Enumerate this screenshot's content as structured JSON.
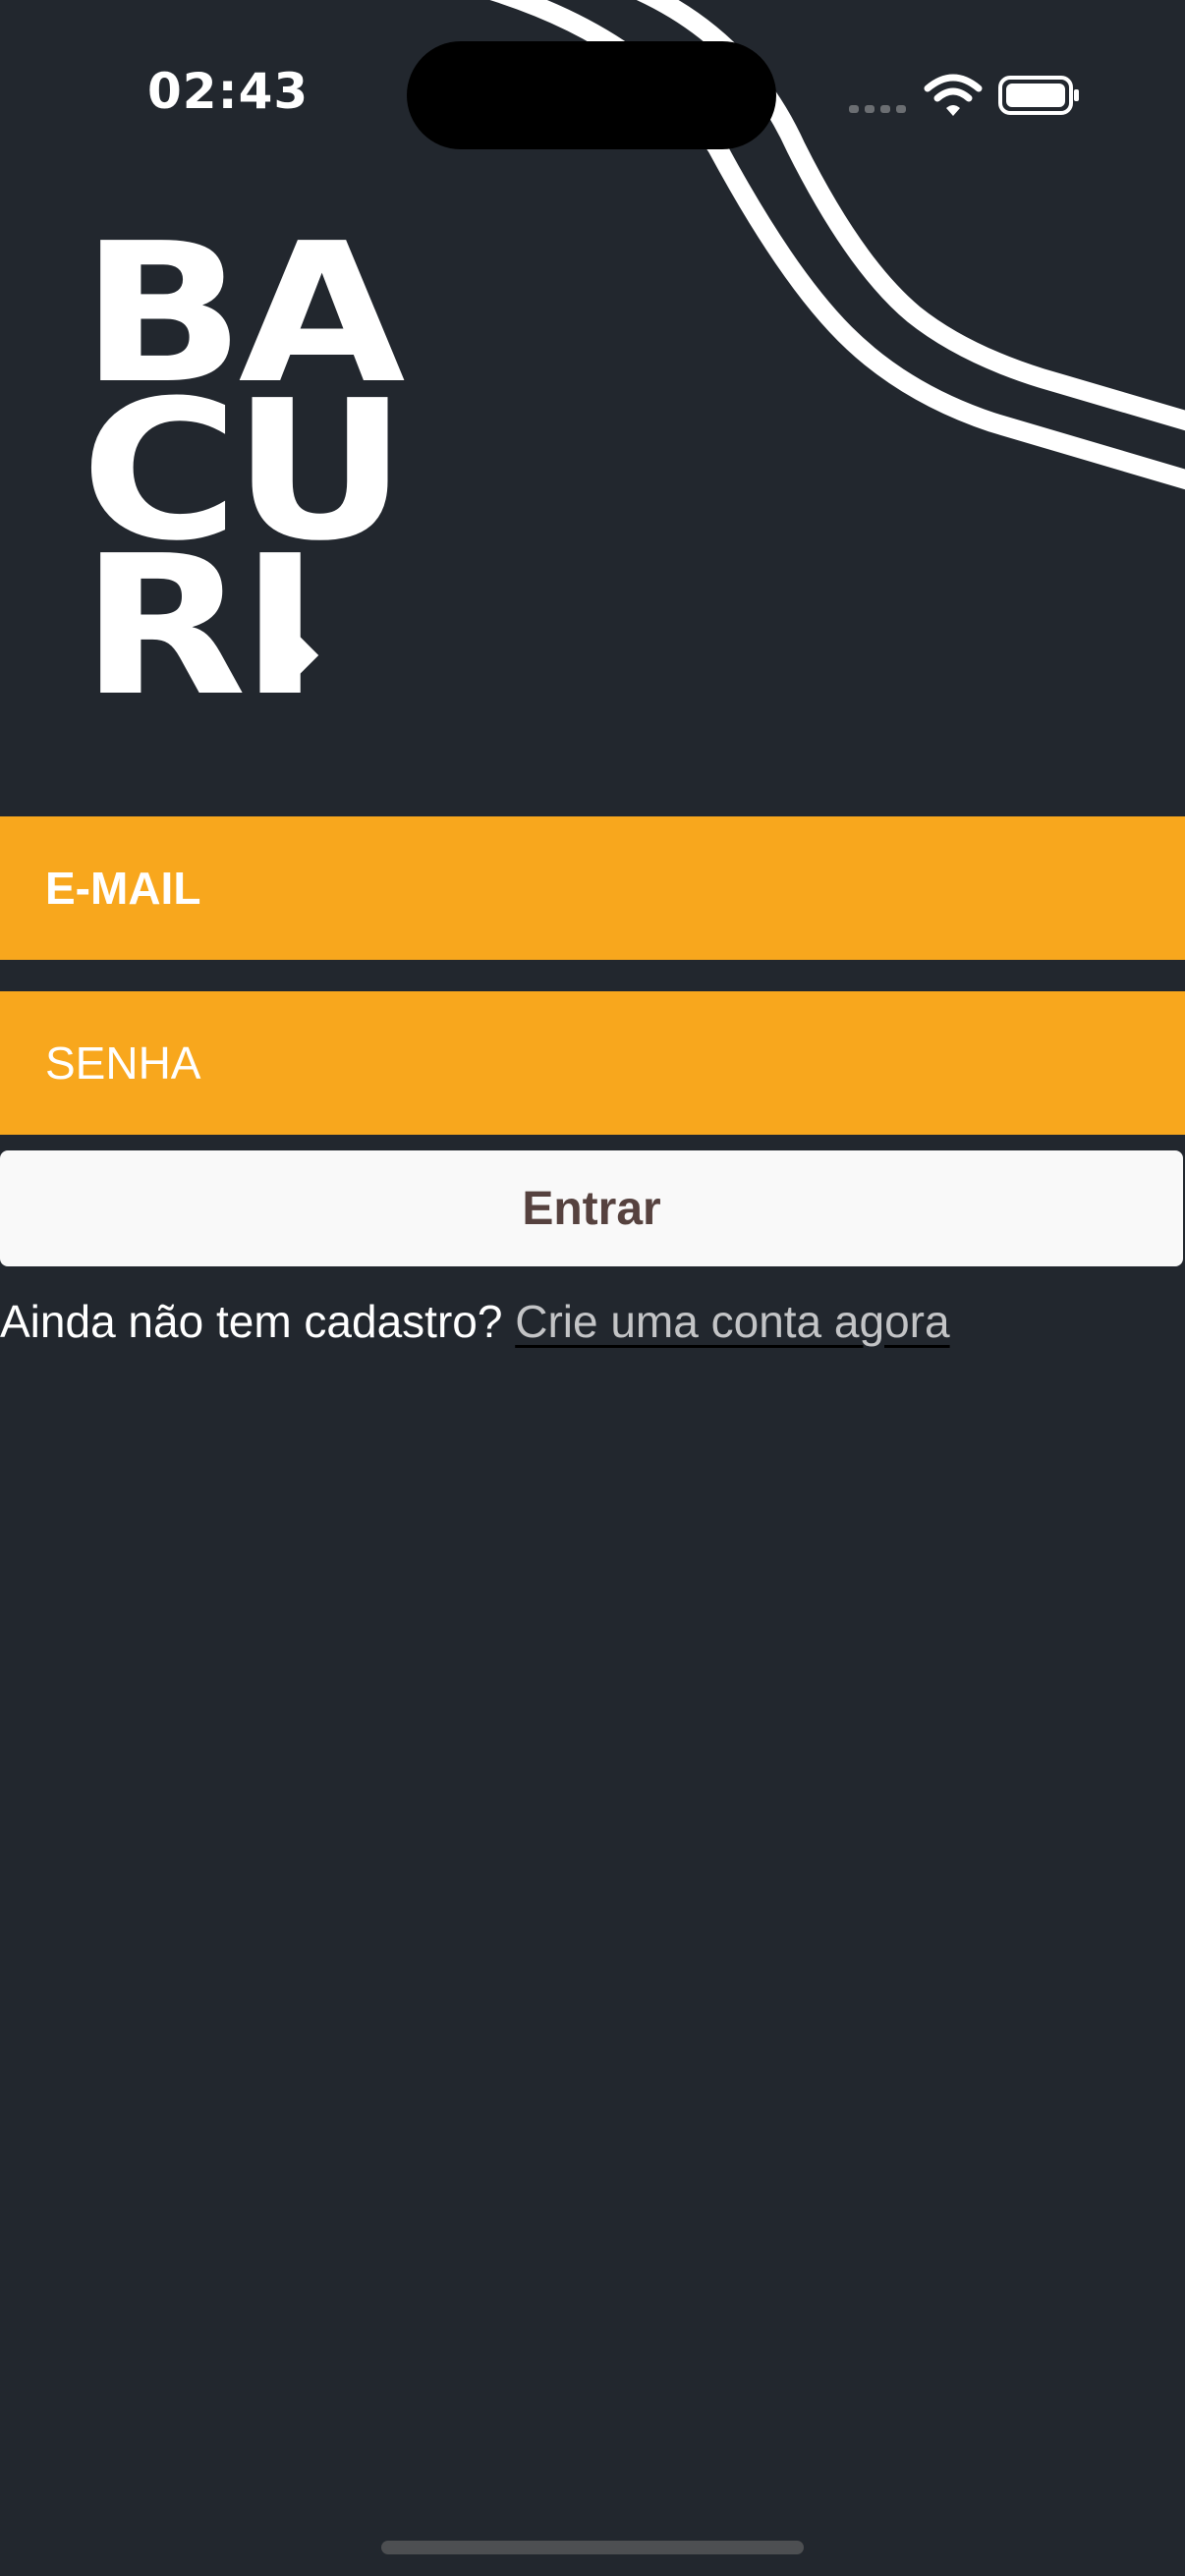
{
  "status_bar": {
    "time": "02:43"
  },
  "logo": {
    "line1": "BA",
    "line2": "CU",
    "line3": "RI"
  },
  "form": {
    "email_label": "E-MAIL",
    "password_label": "SENHA",
    "submit_label": "Entrar"
  },
  "signup": {
    "prompt": "Ainda não tem cadastro?",
    "link_label": "Crie uma conta agora"
  },
  "colors": {
    "background": "#22272e",
    "field_accent": "#f8a71d",
    "button_background": "#f9f9f9",
    "button_text": "#56423f",
    "link_text": "#c3c4c6"
  },
  "icons": {
    "signal": "cellular-signal-icon",
    "wifi": "wifi-icon",
    "battery": "battery-icon"
  }
}
